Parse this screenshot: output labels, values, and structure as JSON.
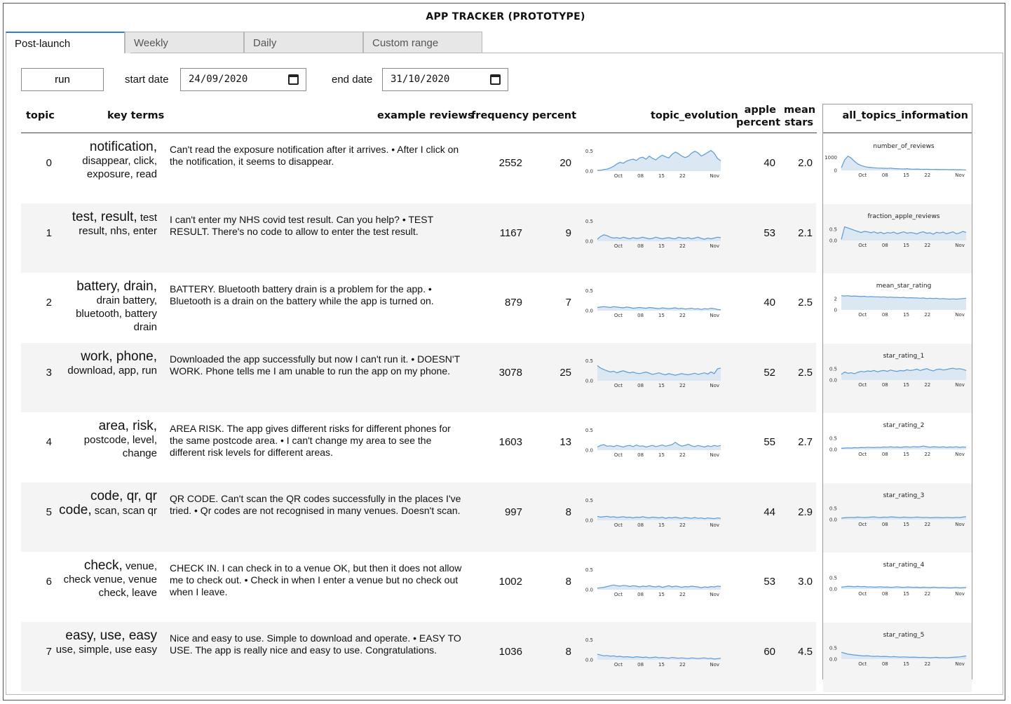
{
  "app": {
    "title": "APP TRACKER (PROTOTYPE)"
  },
  "tabs": [
    {
      "label": "Post-launch",
      "active": true
    },
    {
      "label": "Weekly",
      "active": false
    },
    {
      "label": "Daily",
      "active": false
    },
    {
      "label": "Custom range",
      "active": false
    }
  ],
  "controls": {
    "run_label": "run",
    "start_label": "start date",
    "start_value": "24/09/2020",
    "end_label": "end date",
    "end_value": "31/10/2020"
  },
  "headers": {
    "topic": "topic",
    "key_terms": "key terms",
    "example_reviews": "example reviews",
    "frequency": "frequency",
    "percent": "percent",
    "topic_evolution": "topic_evolution",
    "apple_percent_1": "apple",
    "apple_percent_2": "percent",
    "mean_stars_1": "mean",
    "mean_stars_2": "stars",
    "all_topics": "all_topics_information"
  },
  "mini_axis": {
    "x_ticks": [
      "Oct",
      "08",
      "15",
      "22",
      "Nov"
    ],
    "accent": "#5b9bd5",
    "fill": "#dbe7f3"
  },
  "rows": [
    {
      "topic": "0",
      "terms_big": "notification,",
      "terms_rest": "disappear, click, exposure, read",
      "review": "Can't read the exposure notification after it arrives. • After I click on the notification, it seems to disappear.",
      "frequency": "2552",
      "percent": "20",
      "apple_percent": "40",
      "mean_stars": "2.0",
      "evolution": {
        "y_ticks": [
          "0.5",
          "0.0"
        ],
        "y_max": 0.6,
        "values": [
          0.02,
          0.02,
          0.04,
          0.05,
          0.08,
          0.12,
          0.18,
          0.22,
          0.2,
          0.25,
          0.28,
          0.3,
          0.27,
          0.33,
          0.35,
          0.3,
          0.38,
          0.32,
          0.28,
          0.35,
          0.4,
          0.36,
          0.33,
          0.42,
          0.48,
          0.44,
          0.38,
          0.34,
          0.37,
          0.45,
          0.5,
          0.46,
          0.38,
          0.42,
          0.47,
          0.52,
          0.45,
          0.32,
          0.26
        ]
      }
    },
    {
      "topic": "1",
      "terms_big": "test, result,",
      "terms_rest": "test result, nhs, enter",
      "review": "I can't enter my NHS covid test result. Can you help? • TEST RESULT. There's no code to allow to enter the test result.",
      "frequency": "1167",
      "percent": "9",
      "apple_percent": "53",
      "mean_stars": "2.1",
      "evolution": {
        "y_ticks": [
          "0.5",
          "0.0"
        ],
        "y_max": 0.6,
        "values": [
          0.05,
          0.12,
          0.16,
          0.14,
          0.1,
          0.08,
          0.09,
          0.07,
          0.1,
          0.08,
          0.06,
          0.09,
          0.07,
          0.08,
          0.1,
          0.08,
          0.06,
          0.07,
          0.1,
          0.08,
          0.06,
          0.08,
          0.09,
          0.07,
          0.06,
          0.1,
          0.08,
          0.07,
          0.09,
          0.06,
          0.08,
          0.1,
          0.07,
          0.05,
          0.08,
          0.06,
          0.08,
          0.1,
          0.09
        ]
      }
    },
    {
      "topic": "2",
      "terms_big": "battery, drain,",
      "terms_rest": "drain battery, bluetooth, battery drain",
      "review": "BATTERY. Bluetooth battery drain is a problem for the app. • Bluetooth is a drain on the battery while the app is turned on.",
      "frequency": "879",
      "percent": "7",
      "apple_percent": "40",
      "mean_stars": "2.5",
      "evolution": {
        "y_ticks": [
          "0.5",
          "0.0"
        ],
        "y_max": 0.6,
        "values": [
          0.08,
          0.09,
          0.1,
          0.09,
          0.08,
          0.1,
          0.09,
          0.08,
          0.07,
          0.09,
          0.08,
          0.06,
          0.07,
          0.08,
          0.07,
          0.06,
          0.08,
          0.07,
          0.06,
          0.05,
          0.07,
          0.06,
          0.05,
          0.06,
          0.07,
          0.05,
          0.06,
          0.04,
          0.05,
          0.06,
          0.04,
          0.05,
          0.03,
          0.05,
          0.04,
          0.06,
          0.05,
          0.03,
          0.02
        ]
      }
    },
    {
      "topic": "3",
      "terms_big": "work, phone,",
      "terms_rest": "download, app, run",
      "review": "Downloaded the app successfully but now I can't run it. • DOESN'T WORK. Phone tells me I am unable to run the app on my phone.",
      "frequency": "3078",
      "percent": "25",
      "apple_percent": "52",
      "mean_stars": "2.5",
      "evolution": {
        "y_ticks": [
          "0.5",
          "0.0"
        ],
        "y_max": 0.6,
        "values": [
          0.38,
          0.32,
          0.28,
          0.25,
          0.22,
          0.24,
          0.2,
          0.23,
          0.25,
          0.22,
          0.2,
          0.22,
          0.19,
          0.18,
          0.2,
          0.22,
          0.19,
          0.16,
          0.18,
          0.2,
          0.17,
          0.15,
          0.18,
          0.16,
          0.14,
          0.16,
          0.18,
          0.16,
          0.15,
          0.17,
          0.19,
          0.16,
          0.18,
          0.2,
          0.17,
          0.22,
          0.18,
          0.3,
          0.32
        ]
      }
    },
    {
      "topic": "4",
      "terms_big": "area, risk,",
      "terms_rest": "postcode, level, change",
      "review": "AREA RISK. The app gives different risks for different phones for the same postcode area. • I can't change my area to see the different risk levels for different areas.",
      "frequency": "1603",
      "percent": "13",
      "apple_percent": "55",
      "mean_stars": "2.7",
      "evolution": {
        "y_ticks": [
          "0.5",
          "0.0"
        ],
        "y_max": 0.6,
        "values": [
          0.08,
          0.12,
          0.14,
          0.1,
          0.11,
          0.09,
          0.12,
          0.1,
          0.08,
          0.11,
          0.12,
          0.09,
          0.13,
          0.1,
          0.11,
          0.08,
          0.1,
          0.12,
          0.09,
          0.11,
          0.13,
          0.1,
          0.12,
          0.14,
          0.2,
          0.14,
          0.1,
          0.12,
          0.15,
          0.11,
          0.09,
          0.12,
          0.1,
          0.08,
          0.11,
          0.09,
          0.12,
          0.1,
          0.12
        ]
      }
    },
    {
      "topic": "5",
      "terms_big": "code, qr, qr code,",
      "terms_rest": "scan, scan qr",
      "review": "QR CODE. Can't scan the QR codes successfully in the places I've tried. • Qr codes are not recognised in many venues. Doesn't scan.",
      "frequency": "997",
      "percent": "8",
      "apple_percent": "44",
      "mean_stars": "2.9",
      "evolution": {
        "y_ticks": [
          "0.5",
          "0.0"
        ],
        "y_max": 0.6,
        "values": [
          0.1,
          0.08,
          0.09,
          0.1,
          0.08,
          0.09,
          0.07,
          0.08,
          0.09,
          0.07,
          0.08,
          0.06,
          0.08,
          0.07,
          0.09,
          0.07,
          0.06,
          0.08,
          0.07,
          0.06,
          0.08,
          0.05,
          0.07,
          0.06,
          0.08,
          0.06,
          0.05,
          0.07,
          0.06,
          0.05,
          0.07,
          0.05,
          0.06,
          0.04,
          0.06,
          0.05,
          0.04,
          0.06,
          0.05
        ]
      }
    },
    {
      "topic": "6",
      "terms_big": "check,",
      "terms_rest": "venue, check venue, venue check, leave",
      "review": "CHECK IN. I can check in to a venue OK, but then it does not allow me to check out. • Check in when I enter a venue but no check out when I leave.",
      "frequency": "1002",
      "percent": "8",
      "apple_percent": "53",
      "mean_stars": "3.0",
      "evolution": {
        "y_ticks": [
          "0.5",
          "0.0"
        ],
        "y_max": 0.6,
        "values": [
          0.04,
          0.05,
          0.06,
          0.08,
          0.1,
          0.12,
          0.1,
          0.09,
          0.11,
          0.1,
          0.08,
          0.1,
          0.09,
          0.07,
          0.09,
          0.08,
          0.1,
          0.08,
          0.07,
          0.09,
          0.06,
          0.08,
          0.1,
          0.07,
          0.09,
          0.08,
          0.06,
          0.08,
          0.07,
          0.09,
          0.08,
          0.07,
          0.05,
          0.07,
          0.06,
          0.08,
          0.07,
          0.09,
          0.08
        ]
      }
    },
    {
      "topic": "7",
      "terms_big": "easy, use, easy",
      "terms_rest": "use, simple, use easy",
      "review": "Nice and easy to use. Simple to download and operate. • EASY TO USE. The app is really nice and easy to use. Congratulations.",
      "frequency": "1036",
      "percent": "8",
      "apple_percent": "60",
      "mean_stars": "4.5",
      "evolution": {
        "y_ticks": [
          "0.5",
          "0.0"
        ],
        "y_max": 0.6,
        "values": [
          0.14,
          0.12,
          0.1,
          0.11,
          0.09,
          0.1,
          0.08,
          0.09,
          0.07,
          0.08,
          0.07,
          0.06,
          0.08,
          0.07,
          0.06,
          0.07,
          0.05,
          0.06,
          0.07,
          0.05,
          0.06,
          0.05,
          0.04,
          0.06,
          0.05,
          0.04,
          0.05,
          0.04,
          0.03,
          0.05,
          0.04,
          0.03,
          0.04,
          0.05,
          0.03,
          0.04,
          0.02,
          0.03,
          0.04
        ]
      }
    }
  ],
  "side_charts": [
    {
      "title": "number_of_reviews",
      "y_ticks": [
        "1000",
        "0"
      ],
      "y_max": 1400,
      "values": [
        200,
        800,
        1100,
        950,
        700,
        500,
        380,
        300,
        250,
        220,
        200,
        180,
        170,
        160,
        150,
        170,
        140,
        130,
        120,
        110,
        130,
        100,
        90,
        100,
        85,
        80,
        90,
        75,
        70,
        80,
        60,
        70,
        65,
        55,
        60,
        50,
        55,
        45,
        40
      ]
    },
    {
      "title": "fraction_apple_reviews",
      "y_ticks": [
        "0.5",
        "0.0"
      ],
      "y_max": 0.8,
      "values": [
        0.05,
        0.6,
        0.55,
        0.5,
        0.45,
        0.4,
        0.35,
        0.4,
        0.38,
        0.34,
        0.38,
        0.32,
        0.36,
        0.3,
        0.35,
        0.33,
        0.37,
        0.3,
        0.34,
        0.38,
        0.32,
        0.35,
        0.33,
        0.29,
        0.35,
        0.38,
        0.32,
        0.34,
        0.28,
        0.36,
        0.33,
        0.37,
        0.3,
        0.34,
        0.38,
        0.3,
        0.33,
        0.4,
        0.35
      ]
    },
    {
      "title": "mean_star_rating",
      "y_ticks": [
        "2",
        "0"
      ],
      "y_max": 3.2,
      "values": [
        2.5,
        2.45,
        2.5,
        2.4,
        2.45,
        2.4,
        2.35,
        2.4,
        2.3,
        2.35,
        2.3,
        2.3,
        2.25,
        2.3,
        2.2,
        2.25,
        2.2,
        2.2,
        2.15,
        2.2,
        2.1,
        2.15,
        2.1,
        2.1,
        2.05,
        2.1,
        2.0,
        2.05,
        2.0,
        2.05,
        1.95,
        2.0,
        1.95,
        1.9,
        1.95,
        1.9,
        1.95,
        2.0,
        2.05
      ]
    },
    {
      "title": "star_rating_1",
      "y_ticks": [
        "0.5",
        "0.0"
      ],
      "y_max": 0.8,
      "values": [
        0.25,
        0.35,
        0.3,
        0.32,
        0.28,
        0.34,
        0.38,
        0.36,
        0.4,
        0.38,
        0.42,
        0.36,
        0.4,
        0.42,
        0.38,
        0.44,
        0.4,
        0.38,
        0.42,
        0.4,
        0.45,
        0.42,
        0.44,
        0.48,
        0.42,
        0.46,
        0.5,
        0.44,
        0.4,
        0.46,
        0.48,
        0.44,
        0.46,
        0.5,
        0.52,
        0.48,
        0.5,
        0.47,
        0.42
      ]
    },
    {
      "title": "star_rating_2",
      "y_ticks": [
        "0.5",
        "0.0"
      ],
      "y_max": 0.8,
      "values": [
        0.05,
        0.06,
        0.07,
        0.06,
        0.08,
        0.07,
        0.09,
        0.08,
        0.1,
        0.09,
        0.08,
        0.1,
        0.09,
        0.11,
        0.1,
        0.12,
        0.1,
        0.11,
        0.09,
        0.11,
        0.12,
        0.1,
        0.13,
        0.11,
        0.12,
        0.15,
        0.12,
        0.1,
        0.12,
        0.11,
        0.1,
        0.12,
        0.09,
        0.11,
        0.1,
        0.12,
        0.09,
        0.11,
        0.1
      ]
    },
    {
      "title": "star_rating_3",
      "y_ticks": [
        "0.5",
        "0.0"
      ],
      "y_max": 0.8,
      "values": [
        0.06,
        0.08,
        0.09,
        0.1,
        0.09,
        0.11,
        0.1,
        0.09,
        0.1,
        0.11,
        0.12,
        0.1,
        0.09,
        0.11,
        0.1,
        0.12,
        0.11,
        0.1,
        0.09,
        0.11,
        0.1,
        0.09,
        0.1,
        0.11,
        0.1,
        0.09,
        0.1,
        0.08,
        0.09,
        0.1,
        0.09,
        0.08,
        0.1,
        0.09,
        0.08,
        0.1,
        0.09,
        0.11,
        0.13
      ]
    },
    {
      "title": "star_rating_4",
      "y_ticks": [
        "0.5",
        "0.0"
      ],
      "y_max": 0.8,
      "values": [
        0.08,
        0.1,
        0.12,
        0.11,
        0.1,
        0.12,
        0.1,
        0.11,
        0.09,
        0.1,
        0.08,
        0.09,
        0.1,
        0.08,
        0.09,
        0.07,
        0.08,
        0.1,
        0.08,
        0.07,
        0.09,
        0.08,
        0.07,
        0.08,
        0.06,
        0.08,
        0.07,
        0.06,
        0.08,
        0.07,
        0.06,
        0.07,
        0.06,
        0.05,
        0.06,
        0.07,
        0.05,
        0.06,
        0.07
      ]
    },
    {
      "title": "star_rating_5",
      "y_ticks": [
        "0.5",
        "0.0"
      ],
      "y_max": 0.8,
      "values": [
        0.3,
        0.26,
        0.22,
        0.2,
        0.18,
        0.17,
        0.15,
        0.14,
        0.15,
        0.13,
        0.12,
        0.13,
        0.11,
        0.12,
        0.11,
        0.1,
        0.11,
        0.1,
        0.09,
        0.1,
        0.09,
        0.08,
        0.09,
        0.08,
        0.07,
        0.08,
        0.07,
        0.06,
        0.07,
        0.08,
        0.06,
        0.07,
        0.06,
        0.07,
        0.08,
        0.09,
        0.1,
        0.12,
        0.14
      ]
    }
  ]
}
